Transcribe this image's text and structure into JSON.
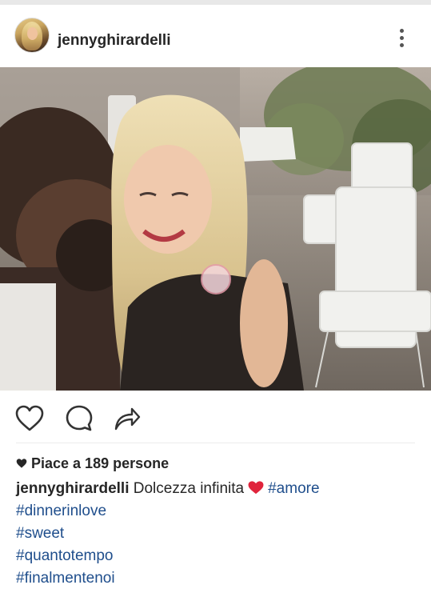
{
  "post": {
    "username": "jennyghirardelli",
    "likes_text": "Piace a 189 persone",
    "caption_user": "jennyghirardelli",
    "caption_text": "Dolcezza infinita",
    "hashtags": [
      "#amore",
      "#dinnerinlove",
      "#sweet",
      "#quantotempo",
      "#finalmentenoi"
    ]
  },
  "icons": {
    "more": "more-options-icon",
    "like": "heart-outline-icon",
    "comment": "comment-icon",
    "share": "share-icon",
    "likes_heart": "heart-filled-icon",
    "caption_heart": "red-heart-emoji"
  },
  "colors": {
    "hashtag": "#1f4e8c",
    "text": "#262626",
    "heart_red": "#e0243c"
  }
}
